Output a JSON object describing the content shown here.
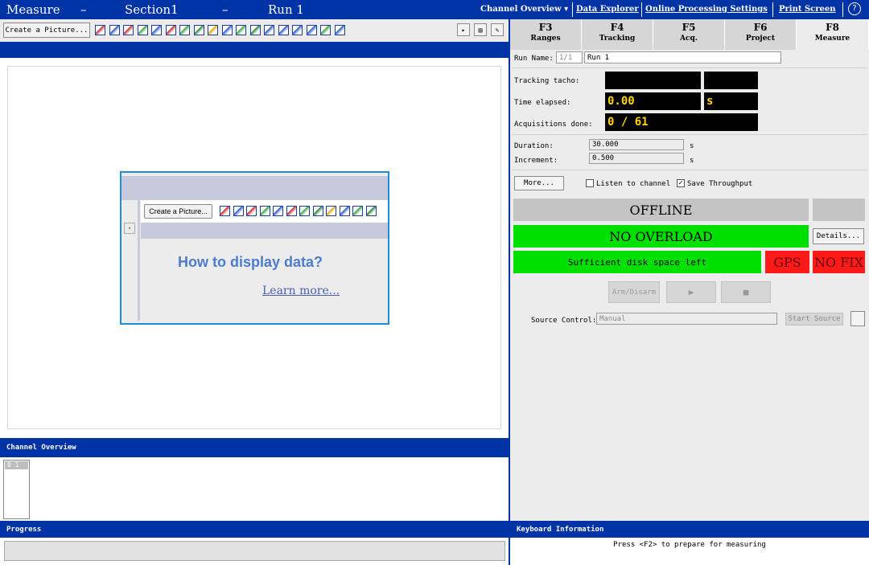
{
  "header": {
    "crumbs": [
      "Measure",
      "Section1",
      "Run 1"
    ],
    "separator": "–",
    "channel_overview": "Channel Overview ▾",
    "links": [
      "Data Explorer",
      "Online Processing Settings",
      "Print Screen"
    ],
    "help": "?"
  },
  "toolbar": {
    "create_picture": "Create a Picture..."
  },
  "placeholder": {
    "create_picture": "Create a Picture...",
    "title": "How to display data?",
    "learn_more": "Learn more..."
  },
  "panels": {
    "channel_overview": "Channel Overview",
    "channel_item": "0 1",
    "progress": "Progress",
    "keyboard_info": "Keyboard Information",
    "keyboard_text": "Press <F2> to prepare for measuring"
  },
  "tabs": [
    {
      "key": "F3",
      "name": "Ranges"
    },
    {
      "key": "F4",
      "name": "Tracking"
    },
    {
      "key": "F5",
      "name": "Acq."
    },
    {
      "key": "F6",
      "name": "Project"
    },
    {
      "key": "F8",
      "name": "Measure"
    }
  ],
  "measure": {
    "run_name_label": "Run Name:",
    "run_index": "1/1",
    "run_name": "Run 1",
    "tracking_tacho_label": "Tracking tacho:",
    "time_elapsed_label": "Time elapsed:",
    "time_elapsed": "0.00",
    "time_unit": "s",
    "acq_done_label": "Acquisitions done:",
    "acq_done": "0 / 61",
    "duration_label": "Duration:",
    "duration": "30.000",
    "duration_unit": "s",
    "increment_label": "Increment:",
    "increment": "0.500",
    "increment_unit": "s",
    "more_button": "More...",
    "listen_label": "Listen to channel",
    "save_label": "Save Throughput",
    "offline": "OFFLINE",
    "no_overload": "NO OVERLOAD",
    "details": "Details...",
    "disk_space": "Sufficient disk space left",
    "gps": "GPS",
    "no_fix": "NO FIX",
    "arm_disarm": "Arm/Disarm",
    "source_control_label": "Source Control:",
    "source_control_value": "Manual",
    "start_source": "Start Source"
  },
  "colors": {
    "header_blue": "#0033a6",
    "green": "#00e000",
    "red": "#ff1a1a",
    "gray": "#c4c4c4"
  }
}
